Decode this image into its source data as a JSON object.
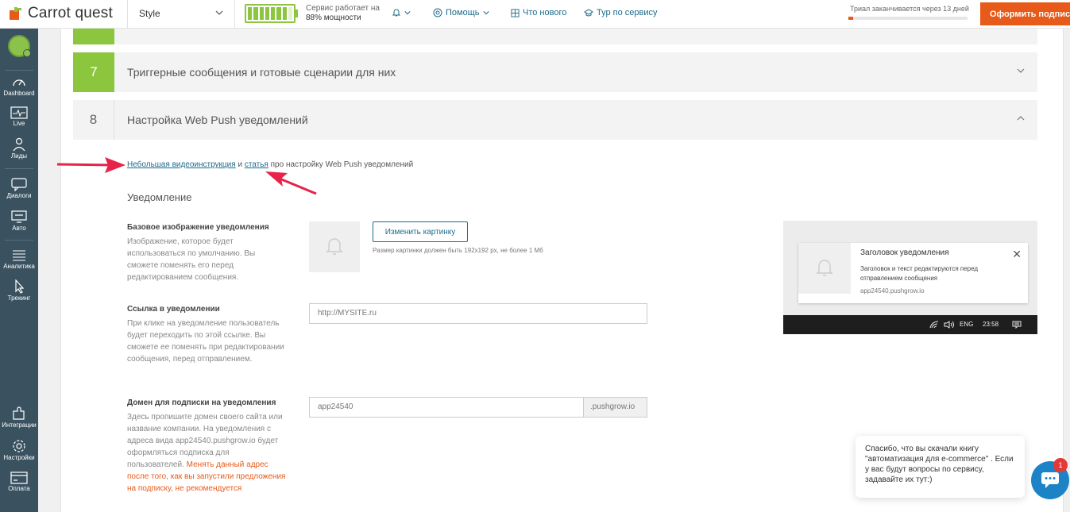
{
  "app": {
    "name": "Carrot quest"
  },
  "header": {
    "style_select": "Style",
    "service_line1": "Сервис работает на",
    "service_line2": "88% мощности",
    "power_percent": 88,
    "help": "Помощь",
    "whats_new": "Что нового",
    "tour": "Тур по сервису",
    "trial_text": "Триал заканчивается через 13 дней",
    "trial_progress_percent": 4,
    "subscribe": "Оформить подписку"
  },
  "sidebar": {
    "items": [
      {
        "label": "Dashboard",
        "icon": "dashboard-icon"
      },
      {
        "label": "Live",
        "icon": "live-icon"
      },
      {
        "label": "Лиды",
        "icon": "leads-icon"
      },
      {
        "label": "Диалоги",
        "icon": "dialogs-icon"
      },
      {
        "label": "Авто",
        "icon": "auto-icon"
      },
      {
        "label": "Аналитика",
        "icon": "analytics-icon"
      },
      {
        "label": "Трекинг",
        "icon": "tracking-icon"
      },
      {
        "label": "Интеграции",
        "icon": "integrations-icon"
      },
      {
        "label": "Настройки",
        "icon": "settings-icon"
      },
      {
        "label": "Оплата",
        "icon": "payment-icon"
      }
    ]
  },
  "steps": [
    {
      "num": "7",
      "title": "Триггерные сообщения и готовые сценарии для них",
      "status": "done"
    },
    {
      "num": "8",
      "title": "Настройка Web Push уведомлений",
      "status": "current"
    }
  ],
  "intro": {
    "link1": "Небольшая видеоинструкция",
    "and": " и ",
    "link2": "статья",
    "rest": " про настройку Web Push уведомлений"
  },
  "section_title": "Уведомление",
  "fields": {
    "image": {
      "title": "Базовое изображение уведомления",
      "desc": "Изображение, которое будет использоваться по умолчанию. Вы сможете поменять его перед редактированием сообщения.",
      "button": "Изменить картинку",
      "hint": "Размер картинки должен быть 192x192 px, не более 1 Мб"
    },
    "link": {
      "title": "Ссылка в уведомлении",
      "desc": "При клике на уведомление пользователь будет переходить по этой ссылке. Вы сможете ее поменять при редактировании сообщения, перед отправлением.",
      "value": "http://MYSITE.ru"
    },
    "domain": {
      "title": "Домен для подписки на уведомления",
      "desc": "Здесь пропишите домен своего сайта или название компании. На уведомления с адреса вида app24540.pushgrow.io будет оформляться подписка для пользователей. ",
      "warn": "Менять данный адрес после того, как вы запустили предложения на подписку, не рекомендуется",
      "value": "app24540",
      "suffix": ".pushgrow.io"
    }
  },
  "preview": {
    "title": "Заголовок уведомления",
    "text": "Заголовок и текст редактируются перед отправлением сообщения",
    "domain": "app24540.pushgrow.io",
    "lang": "ENG",
    "time": "23:58"
  },
  "chat": {
    "message": "Спасибо, что вы скачали книгу \"автоматизация для e-commerce\" . Если у вас будут вопросы по сервису, задавайте их тут:)",
    "badge": "1"
  },
  "colors": {
    "accent": "#e85a1a",
    "brand_green": "#8cc63f",
    "sidebar": "#3a5260",
    "link": "#1d6b8a",
    "annotation_arrow": "#e8234a"
  }
}
